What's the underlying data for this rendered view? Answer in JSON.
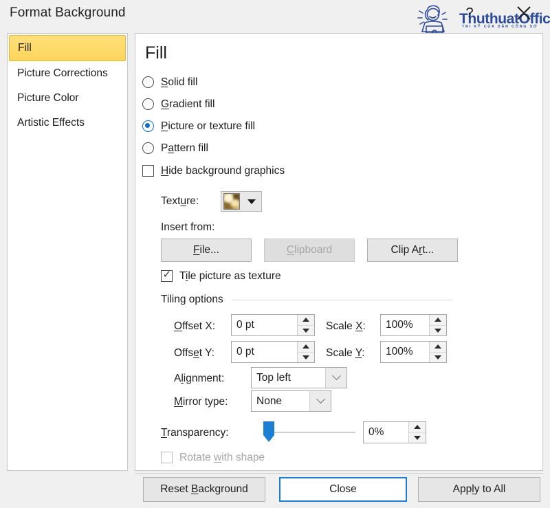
{
  "dialog": {
    "title": "Format Background",
    "help_icon": "?",
    "close_icon": "close-x"
  },
  "watermark": {
    "brand": "ThuthuatOffice",
    "tagline": "TRI KỸ CỦA DÂN CÔNG SỞ",
    "color": "#2b4a9b"
  },
  "sidebar": {
    "items": [
      {
        "label": "Fill",
        "selected": true
      },
      {
        "label": "Picture Corrections",
        "selected": false
      },
      {
        "label": "Picture Color",
        "selected": false
      },
      {
        "label": "Artistic Effects",
        "selected": false
      }
    ],
    "selected_bg": "#fdd45d"
  },
  "panel": {
    "heading": "Fill",
    "fill_options": [
      {
        "label_pre": "",
        "label_key": "S",
        "label_post": "olid fill",
        "selected": false
      },
      {
        "label_pre": "",
        "label_key": "G",
        "label_post": "radient fill",
        "selected": false
      },
      {
        "label_pre": "",
        "label_key": "P",
        "label_post": "icture or texture fill",
        "selected": true
      },
      {
        "label_pre": "P",
        "label_key": "a",
        "label_post": "ttern fill",
        "selected": false
      }
    ],
    "hide_bg": {
      "label_pre": "",
      "label_key": "H",
      "label_post": "ide background graphics",
      "checked": false
    },
    "texture": {
      "label_pre": "Text",
      "label_key": "u",
      "label_post": "re:",
      "swatch_name": "papyrus-texture"
    },
    "insert_from": {
      "label": "Insert from:",
      "buttons": [
        {
          "pre": "",
          "key": "F",
          "post": "ile...",
          "disabled": false
        },
        {
          "pre": "",
          "key": "C",
          "post": "lipboard",
          "disabled": true
        },
        {
          "pre": "Clip A",
          "key": "r",
          "post": "t...",
          "disabled": false
        }
      ]
    },
    "tile_checkbox": {
      "label_pre": "T",
      "label_key": "i",
      "label_post": "le picture as texture",
      "checked": true
    },
    "tiling": {
      "group_label": "Tiling options",
      "fields": [
        {
          "label_pre": "",
          "label_key": "O",
          "label_post": "ffset X:",
          "value": "0 pt"
        },
        {
          "label_pre": "",
          "label_key": "X",
          "label_post": "",
          "label_full_pre": "Scale ",
          "label_full_post": ":",
          "value": "100%"
        },
        {
          "label_pre": "Offs",
          "label_key": "e",
          "label_post": "t Y:",
          "value": "0 pt"
        },
        {
          "label_full_pre": "Scale ",
          "label_key": "Y",
          "label_full_post": ":",
          "value": "100%"
        }
      ],
      "offset_x_label_pre": "",
      "offset_x_key": "O",
      "offset_x_post": "ffset X:",
      "offset_x_value": "0 pt",
      "offset_y_pre": "Offs",
      "offset_y_key": "e",
      "offset_y_post": "t Y:",
      "offset_y_value": "0 pt",
      "scale_x_pre": "Scale ",
      "scale_x_key": "X",
      "scale_x_post": ":",
      "scale_x_value": "100%",
      "scale_y_pre": "Scale ",
      "scale_y_key": "Y",
      "scale_y_post": ":",
      "scale_y_value": "100%",
      "alignment_pre": "A",
      "alignment_key": "l",
      "alignment_post": "ignment:",
      "alignment_value": "Top left",
      "mirror_pre": "",
      "mirror_key": "M",
      "mirror_post": "irror type:",
      "mirror_value": "None"
    },
    "transparency": {
      "label_pre": "",
      "label_key": "T",
      "label_post": "ransparency:",
      "value": "0%",
      "slider_percent": 0,
      "thumb_color": "#1b7fd4"
    },
    "rotate_with_shape": {
      "label_pre": "Rotate ",
      "label_key": "w",
      "label_post": "ith shape",
      "checked": false,
      "disabled": true
    }
  },
  "footer": {
    "buttons": [
      {
        "pre": "Reset ",
        "key": "B",
        "post": "ackground",
        "focus": false
      },
      {
        "pre": "Close",
        "key": "",
        "post": "",
        "focus": true
      },
      {
        "pre": "App",
        "key": "l",
        "post": "y to All",
        "focus": false
      }
    ]
  }
}
